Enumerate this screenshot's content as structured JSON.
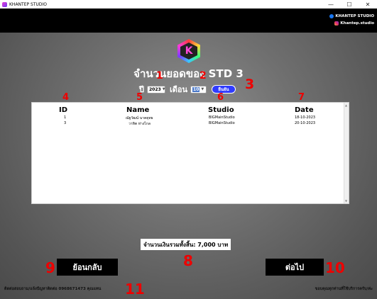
{
  "window": {
    "title": "KHANTEP STUDIO",
    "minimize": "—",
    "maximize": "☐",
    "close": "✕"
  },
  "social": {
    "facebook": "KHANTEP STUDIO",
    "instagram": "Khantep.studio"
  },
  "logo": {
    "letter": "K",
    "icon": "khantep-logo-icon"
  },
  "page": {
    "title": "จำนวนยอดของ STD 3"
  },
  "filters": {
    "year_label": "ปี",
    "year_value": "2023",
    "month_label": "เดือน",
    "month_value": "10",
    "confirm_label": "ยืนยัน"
  },
  "table": {
    "columns": [
      "ID",
      "Name",
      "Studio",
      "Date"
    ],
    "rows": [
      {
        "id": "1",
        "name": "ณัฐวัฒน์ นาคยุทธ",
        "studio": "BIGMainStudio",
        "date": "18-10-2023"
      },
      {
        "id": "3",
        "name": "วาทิต ห่างไกล",
        "studio": "BIGMainStudio",
        "date": "20-10-2023"
      }
    ]
  },
  "summary": {
    "total_text": "จำนวนเงินรวมทั้งสิ้น: 7,000 บาท"
  },
  "buttons": {
    "back": "ย้อนกลับ",
    "next": "ต่อไป"
  },
  "footer": {
    "contact": "ติดต่อสอบถาม/แจ้งปัญหาติดต่อ 0968671473 คุณแทน",
    "thanks": "ขอบคุณทุกท่านที่ใช้บริการครับ/ค่ะ"
  },
  "annotations": [
    "1",
    "2",
    "3",
    "4",
    "5",
    "6",
    "7",
    "8",
    "9",
    "10",
    "11"
  ],
  "colors": {
    "annotation": "#e00000",
    "confirm_button": "#2f3bff",
    "background": "#707070"
  }
}
